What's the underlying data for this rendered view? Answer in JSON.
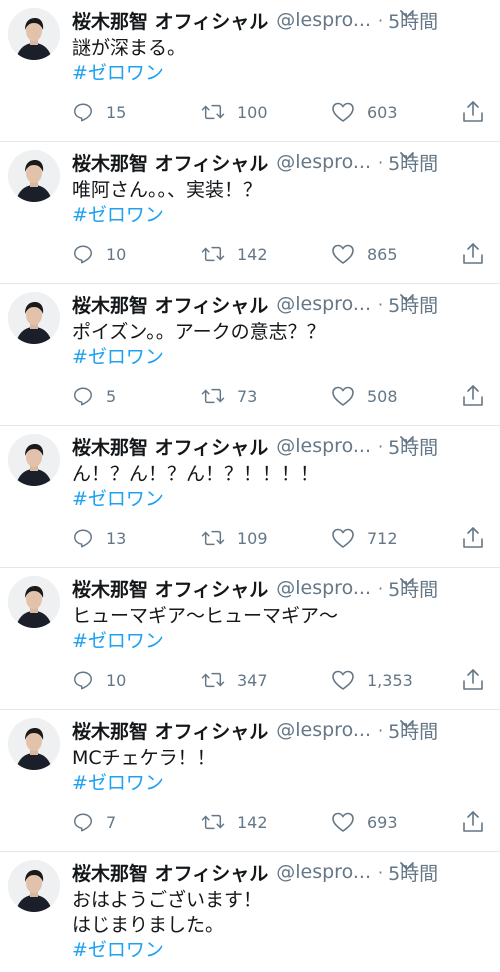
{
  "tweets": [
    {
      "name": "桜木那智 オフィシャル",
      "handle": "@lespro...",
      "dot": "·",
      "time": "5時間",
      "text": "謎が深まる。",
      "hashtag": "#ゼロワン",
      "replies": "15",
      "retweets": "100",
      "likes": "603"
    },
    {
      "name": "桜木那智 オフィシャル",
      "handle": "@lespro...",
      "dot": "·",
      "time": "5時間",
      "text": "唯阿さん。。、実装！？",
      "hashtag": "#ゼロワン",
      "replies": "10",
      "retweets": "142",
      "likes": "865"
    },
    {
      "name": "桜木那智 オフィシャル",
      "handle": "@lespro...",
      "dot": "·",
      "time": "5時間",
      "text": "ポイズン。。アークの意志？？",
      "hashtag": "#ゼロワン",
      "replies": "5",
      "retweets": "73",
      "likes": "508"
    },
    {
      "name": "桜木那智 オフィシャル",
      "handle": "@lespro...",
      "dot": "·",
      "time": "5時間",
      "text": "ん！？ん！？ん！？！！！！",
      "hashtag": "#ゼロワン",
      "replies": "13",
      "retweets": "109",
      "likes": "712"
    },
    {
      "name": "桜木那智 オフィシャル",
      "handle": "@lespro...",
      "dot": "·",
      "time": "5時間",
      "text": "ヒューマギア〜ヒューマギア〜",
      "hashtag": "#ゼロワン",
      "replies": "10",
      "retweets": "347",
      "likes": "1,353"
    },
    {
      "name": "桜木那智 オフィシャル",
      "handle": "@lespro...",
      "dot": "·",
      "time": "5時間",
      "text": "MCチェケラ！！",
      "hashtag": "#ゼロワン",
      "replies": "7",
      "retweets": "142",
      "likes": "693"
    },
    {
      "name": "桜木那智 オフィシャル",
      "handle": "@lespro...",
      "dot": "·",
      "time": "5時間",
      "text": "おはようございます！\nはじまりました。",
      "hashtag": "#ゼロワン"
    }
  ],
  "colors": {
    "link": "#1da1f2",
    "secondary_text": "#657786",
    "primary_text": "#14171a",
    "divider": "#e1e8ed"
  },
  "icons": {
    "avatar": "avatar-photo",
    "caret": "chevron-down-icon",
    "reply": "reply-icon",
    "retweet": "retweet-icon",
    "like": "heart-icon",
    "share": "share-icon"
  }
}
